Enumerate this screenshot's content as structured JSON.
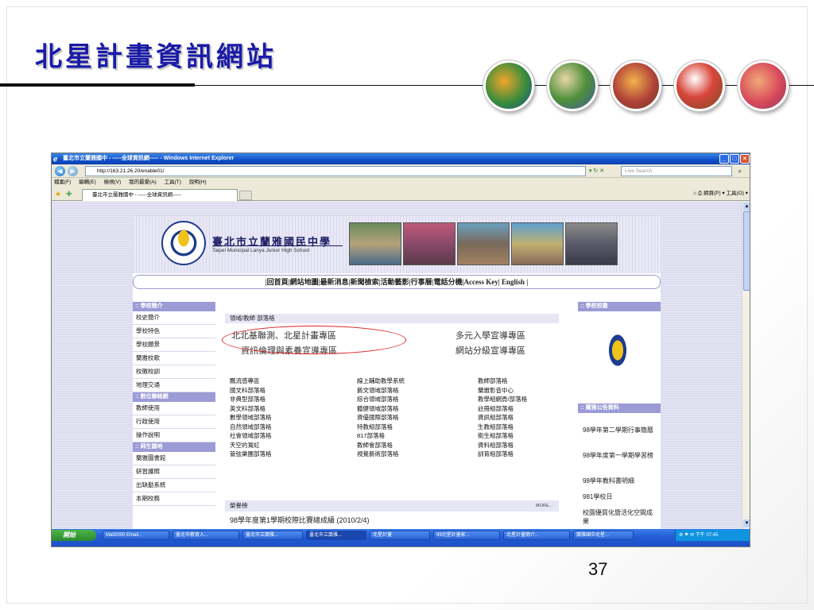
{
  "slide": {
    "title": "北星計畫資訊網站",
    "page_number": "37"
  },
  "browser": {
    "window_title": "臺北市立蘭雅國中 - -----全球資訊網----- - Windows Internet Explorer",
    "address": "http://163.21.26.20/enable01/",
    "search_placeholder": "Live Search",
    "menu": [
      "檔案(F)",
      "編輯(E)",
      "檢視(V)",
      "我的最愛(A)",
      "工具(T)",
      "說明(H)"
    ],
    "tab_label": "臺北市立蘭雅國中 - -----全球資訊網-----",
    "tools": "網頁(P) ▾  工具(O) ▾"
  },
  "site": {
    "school_name": "臺北市立蘭雅國民中學",
    "school_en": "Taipei Municipal Lanya Junior High School",
    "nav": "|回首頁|網站地圖|最新消息|新聞檢索|活動藝影|行事曆|電話分機|Access Key| English |",
    "left": {
      "sections": [
        {
          "title": ":: 學校簡介",
          "items": [
            "校史簡介",
            "學校特色",
            "學校願景",
            "蘭雅校歌",
            "校徽校訓",
            "地理交通"
          ]
        },
        {
          "title": ":: 數位聯絡網",
          "items": [
            "教師使用",
            "行政使用",
            "操作說明"
          ]
        },
        {
          "title": ":: 師生園地",
          "items": [
            "蘭雅圖書館",
            "研習護照",
            "出缺勤系統",
            "本期校務"
          ]
        }
      ]
    },
    "center": {
      "sub_heading": "領域/教師 部落格",
      "features": [
        "北北基聯測、北星計畫專區",
        "多元入學宣導專區",
        "資訊倫理與素養宣導專區",
        "網站分級宣導專區"
      ],
      "blogs": [
        [
          "飄流感專區",
          "國文科部落格",
          "非典型部落格",
          "英文科部落格",
          "數學領域部落格",
          "自然領域部落格",
          "社會領域部落格",
          "天空的寬虹",
          "管弦樂團部落格"
        ],
        [
          "線上輔助教學系統",
          "藝文領域部落格",
          "綜合領域部落格",
          "體健領域部落格",
          "資優國際部落格",
          "特教組部落格",
          "817部落格",
          "教師會部落格",
          "視覺藝術部落格"
        ],
        [
          "教師部落格",
          "蘭雅影音中心",
          "教學組網頁/部落格",
          "註冊組部落格",
          "資訊組部落格",
          "生教組部落格",
          "衛生組部落格",
          "資料組部落格",
          "訓育組部落格"
        ]
      ],
      "honor_heading": "榮譽榜",
      "honor_more": "MORE...",
      "honor_item": "98學年度第1學期校際比賽總成績 (2010/2/4)"
    },
    "right": {
      "emblem_heading": ":: 學校校徽",
      "news_heading": ":: 蘭雅公告資料",
      "news": [
        "98學年第二學期行事簡曆",
        "98學年度第一學期學習榜",
        "98學年教科書明細",
        "981學校日",
        "校園優質化暨活化空間成果"
      ]
    }
  },
  "taskbar": {
    "start": "開始",
    "tasks": [
      "Mail2000 Email...",
      "臺北市教育入...",
      "臺北市立蘭雅...",
      "臺北市立蘭雅...",
      "北星計畫",
      "99北星計畫家...",
      "北星計畫簡介...",
      "蘭雅國中北星..."
    ],
    "clock": "下午 07:45"
  }
}
